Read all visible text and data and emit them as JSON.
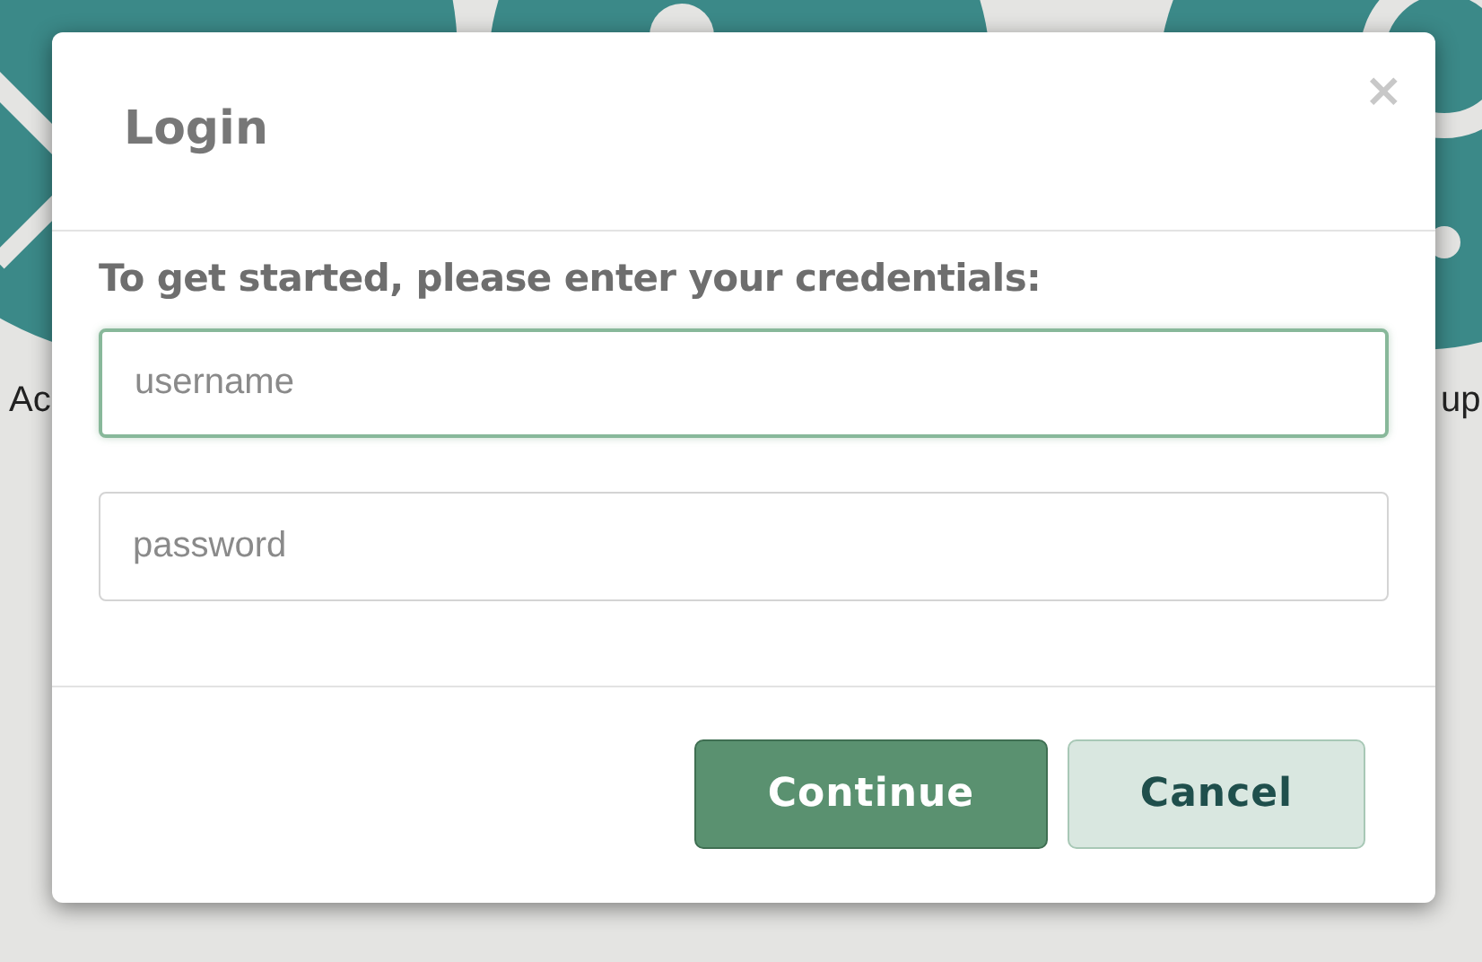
{
  "background": {
    "tiles": [
      {
        "label": "Ac"
      },
      {
        "label": "up"
      }
    ]
  },
  "dialog": {
    "title": "Login",
    "close": "×",
    "prompt": "To get started, please enter your credentials:",
    "fields": [
      {
        "placeholder": "username",
        "focused": true
      },
      {
        "placeholder": "password",
        "focused": false
      }
    ],
    "buttons": [
      {
        "label": "Continue",
        "kind": "primary"
      },
      {
        "label": "Cancel",
        "kind": "secondary"
      }
    ]
  }
}
